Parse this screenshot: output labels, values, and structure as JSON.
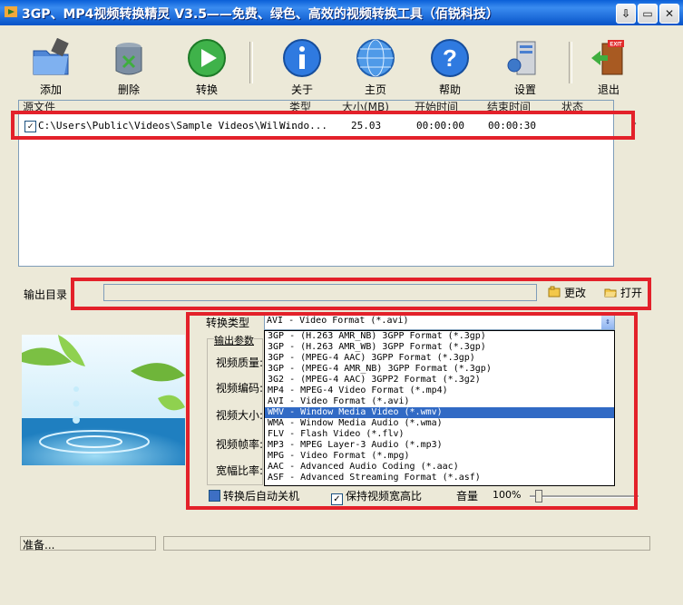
{
  "window": {
    "title": "3GP、MP4视频转换精灵 V3.5——免费、绿色、高效的视频转换工具（佰锐科技）"
  },
  "toolbar": {
    "add": "添加",
    "delete": "删除",
    "convert": "转换",
    "about": "关于",
    "home": "主页",
    "help": "帮助",
    "settings": "设置",
    "exit": "退出"
  },
  "file_list": {
    "columns": [
      "源文件",
      "类型",
      "大小(MB)",
      "开始时间",
      "结束时间",
      "状态"
    ],
    "rows": [
      {
        "checked": true,
        "source": "C:\\Users\\Public\\Videos\\Sample Videos\\Wil...",
        "type": "Windo...",
        "size": "25.03",
        "start": "00:00:00",
        "end": "00:00:30",
        "status": ""
      }
    ]
  },
  "output": {
    "label": "输出目录",
    "path": "",
    "change": "更改",
    "open": "打开"
  },
  "convert_type": {
    "label": "转换类型",
    "selected": "AVI - Video Format (*.avi)",
    "options": [
      "3GP - (H.263 AMR_NB) 3GPP Format (*.3gp)",
      "3GP - (H.263 AMR_WB) 3GPP Format (*.3gp)",
      "3GP - (MPEG-4 AAC) 3GPP Format (*.3gp)",
      "3GP - (MPEG-4 AMR_NB) 3GPP Format (*.3gp)",
      "3G2 - (MPEG-4 AAC) 3GPP2 Format (*.3g2)",
      "MP4 - MPEG-4 Video Format (*.mp4)",
      "AVI - Video Format (*.avi)",
      "WMV - Window Media Video (*.wmv)",
      "WMA - Window Media Audio (*.wma)",
      "FLV - Flash Video (*.flv)",
      "MP3 - MPEG Layer-3 Audio (*.mp3)",
      "MPG - Video Format (*.mpg)",
      "AAC - Advanced Audio Coding (*.aac)",
      "ASF - Advanced Streaming Format (*.asf)"
    ],
    "highlighted_index": 7
  },
  "params": {
    "group": "输出参数",
    "quality": "视频质量:",
    "codec": "视频编码:",
    "size": "视频大小:",
    "framerate": "视频帧率:",
    "aspect": "宽幅比率:"
  },
  "options": {
    "shutdown": "转换后自动关机",
    "keep_ratio": "保持视频宽高比",
    "volume_label": "音量",
    "volume_value": "100%",
    "volume_level": 0.05
  },
  "status": {
    "text": "准备..."
  },
  "colors": {
    "accent": "#316ac5",
    "highlight_box": "#e3212a",
    "titlebar": "#0a5fd8"
  }
}
